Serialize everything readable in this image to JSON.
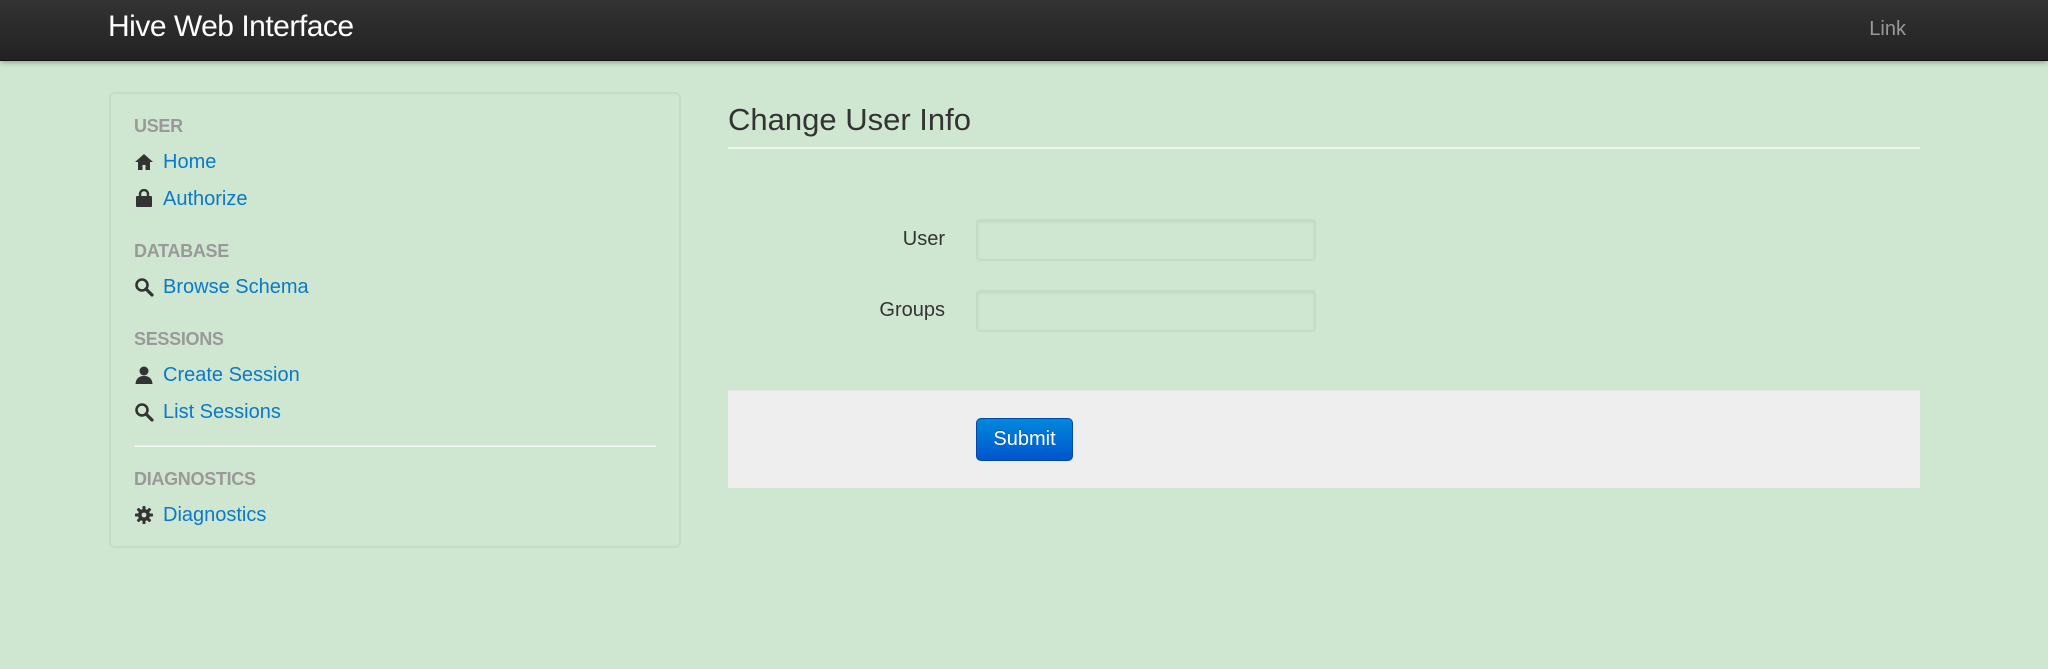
{
  "navbar": {
    "brand": "Hive Web Interface",
    "link": "Link"
  },
  "sidebar": {
    "user_header": "USER",
    "home": "Home",
    "authorize": "Authorize",
    "database_header": "DATABASE",
    "browse_schema": "Browse Schema",
    "sessions_header": "SESSIONS",
    "create_session": "Create Session",
    "list_sessions": "List Sessions",
    "diagnostics_header": "DIAGNOSTICS",
    "diagnostics": "Diagnostics",
    "icons": {
      "home": "home-icon",
      "authorize": "lock-icon",
      "browse_schema": "search-icon",
      "create_session": "user-icon",
      "list_sessions": "search-icon",
      "diagnostics": "gear-icon"
    }
  },
  "main": {
    "title": "Change User Info",
    "form": {
      "user_label": "User",
      "user_value": "",
      "groups_label": "Groups",
      "groups_value": "",
      "submit_label": "Submit"
    }
  },
  "colors": {
    "background": "#cfe7d1",
    "navbar": "#2b2b2b",
    "link": "#0a79c8",
    "nav_header": "#999999",
    "button": "#0069d4",
    "form_actions": "#eeeeee"
  }
}
